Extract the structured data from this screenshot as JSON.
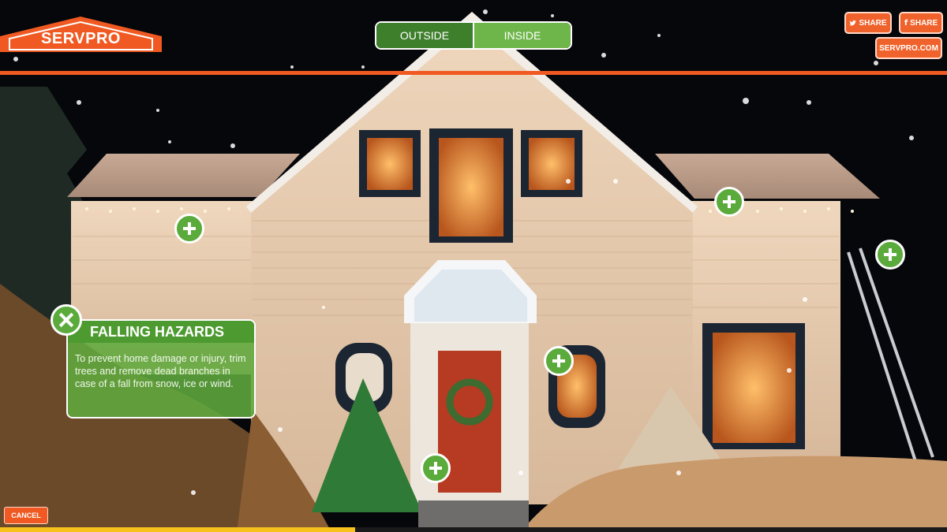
{
  "brand": {
    "logo_text": "SERVPRO",
    "accent": "#f05a22"
  },
  "view_toggle": {
    "outside": "OUTSIDE",
    "inside": "INSIDE",
    "active": "OUTSIDE"
  },
  "top_right": {
    "twitter_share": "SHARE",
    "facebook_share": "SHARE",
    "site_link": "SERVPRO.COM"
  },
  "info_panel": {
    "title": "FALLING HAZARDS",
    "body": "To prevent home damage or injury, trim trees and remove dead branches in case of a fall from snow, ice or wind."
  },
  "hotspots": [
    {
      "name": "hotspot-left-roof"
    },
    {
      "name": "hotspot-right-roof"
    },
    {
      "name": "hotspot-ladder"
    },
    {
      "name": "hotspot-porch-light"
    },
    {
      "name": "hotspot-front-steps"
    }
  ],
  "footer": {
    "cancel": "CANCEL",
    "progress_fraction": 0.375
  },
  "icons": {
    "twitter": "twitter-icon",
    "facebook": "facebook-icon",
    "plus": "plus-icon",
    "close": "close-icon"
  }
}
